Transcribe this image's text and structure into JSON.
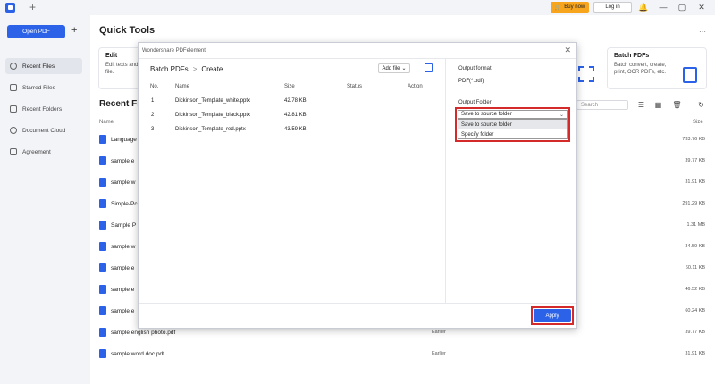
{
  "titlebar": {
    "buy_now": "Buy now",
    "login": "Log in",
    "tab_plus": "+",
    "bell": "🔔",
    "minimize": "—",
    "maximize": "▢",
    "close": "✕"
  },
  "sidebar": {
    "open_pdf": "Open PDF",
    "add": "+",
    "items": [
      {
        "label": "Recent Files",
        "icon": "clock-icon",
        "active": true
      },
      {
        "label": "Starred Files",
        "icon": "star-icon",
        "active": false
      },
      {
        "label": "Recent Folders",
        "icon": "folder-icon",
        "active": false
      },
      {
        "label": "Document Cloud",
        "icon": "cloud-icon",
        "active": false
      },
      {
        "label": "Agreement",
        "icon": "document-icon",
        "active": false
      }
    ]
  },
  "main": {
    "quick_tools_title": "Quick Tools",
    "more": "···",
    "cards": [
      {
        "title": "Edit",
        "desc": "Edit texts and\nfile."
      },
      {
        "title": "Batch PDFs",
        "desc": "Batch convert, create,\nprint, OCR PDFs, etc."
      }
    ],
    "recent_files_title": "Recent Fil",
    "name_header": "Name",
    "size_header": "Size",
    "search_placeholder": "Search",
    "files": [
      {
        "name": "Language",
        "date": "",
        "size": "733.76 KB"
      },
      {
        "name": "sample e",
        "date": "",
        "size": "39.77 KB"
      },
      {
        "name": "sample w",
        "date": "",
        "size": "31.91 KB"
      },
      {
        "name": "Simple-Pc",
        "date": "",
        "size": "291.29 KB"
      },
      {
        "name": "Sample P",
        "date": "",
        "size": "1.31 MB"
      },
      {
        "name": "sample w",
        "date": "",
        "size": "34.59 KB"
      },
      {
        "name": "sample e",
        "date": "",
        "size": "60.11 KB"
      },
      {
        "name": "sample e",
        "date": "",
        "size": "46.52 KB"
      },
      {
        "name": "sample e",
        "date": "",
        "size": "60.24 KB"
      },
      {
        "name": "sample english photo.pdf",
        "date": "Earlier",
        "size": "39.77 KB"
      },
      {
        "name": "sample word doc.pdf",
        "date": "Earlier",
        "size": "31.91 KB"
      }
    ]
  },
  "dialog": {
    "title": "Wondershare PDFelement",
    "close": "✕",
    "crumb_root": "Batch PDFs",
    "crumb_sep": ">",
    "crumb_current": "Create",
    "add_file": "Add file",
    "add_file_caret": "⌄",
    "headers": {
      "no": "No.",
      "name": "Name",
      "size": "Size",
      "status": "Status",
      "action": "Action"
    },
    "rows": [
      {
        "no": "1",
        "name": "Dickinson_Template_white.pptx",
        "size": "42.78 KB"
      },
      {
        "no": "2",
        "name": "Dickinson_Template_black.pptx",
        "size": "42.81 KB"
      },
      {
        "no": "3",
        "name": "Dickinson_Template_red.pptx",
        "size": "43.59 KB"
      }
    ],
    "output_format_label": "Output format",
    "output_format_value": "PDF(*.pdf)",
    "output_folder_label": "Output Folder",
    "output_folder_selected": "Save to source folder",
    "output_folder_options": [
      "Save to source folder",
      "Specify folder"
    ],
    "apply": "Apply"
  },
  "colors": {
    "accent": "#2b62e8",
    "buy": "#f7a51c",
    "highlight": "#d42a2a"
  }
}
